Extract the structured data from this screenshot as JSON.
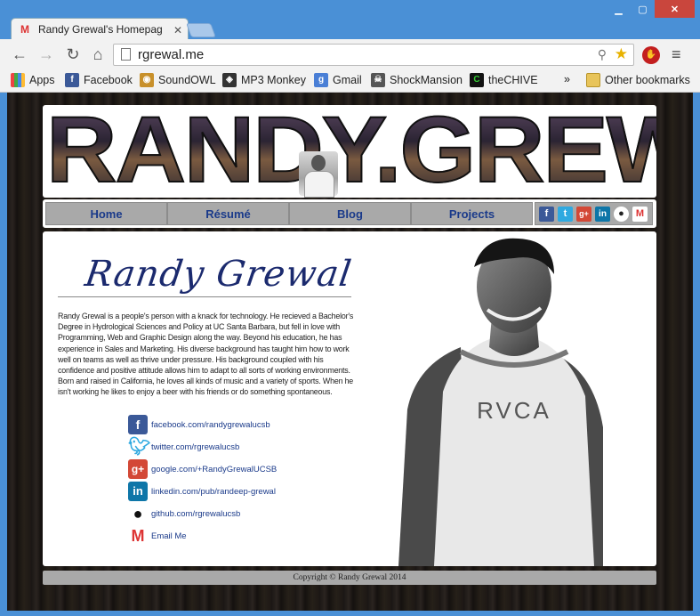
{
  "browser": {
    "tab_title": "Randy Grewal's Homepag",
    "url": "rgrewal.me",
    "bookmarks": [
      "Apps",
      "Facebook",
      "SoundOWL",
      "MP3 Monkey",
      "Gmail",
      "ShockMansion",
      "theCHIVE"
    ],
    "overflow": "»",
    "other_bookmarks": "Other bookmarks"
  },
  "site": {
    "banner_title": "RANDY.GREWAL",
    "nav": [
      "Home",
      "Résumé",
      "Blog",
      "Projects"
    ],
    "signature": "Randy Grewal",
    "bio": "Randy Grewal is a people's person with a knack for technology. He recieved a Bachelor's Degree in Hydrological Sciences and Policy at UC Santa Barbara, but fell in love with Programming, Web and Graphic Design along the way. Beyond his education, he has experience in Sales and Marketing. His diverse background has taught him how to work well on teams as well as thrive under pressure. His background coupled with his confidence and positive attitude allows him to adapt to all sorts of working environments. Born and raised in California, he loves all kinds of music and a variety of sports. When he isn't working he likes to enjoy a beer with his friends or do something spontaneous.",
    "links": {
      "facebook": "facebook.com/randygrewalucsb",
      "twitter": "twitter.com/rgrewalucsb",
      "google": "google.com/+RandyGrewalUCSB",
      "linkedin": "linkedin.com/pub/randeep-grewal",
      "github": "github.com/rgrewalucsb",
      "email": "Email Me"
    },
    "shirt_text": "RVCA",
    "footer": "Copyright © Randy Grewal 2014"
  },
  "colors": {
    "nav_text": "#1a3a8a",
    "nav_bg": "#a9a9a9",
    "signature": "#1b2a6e",
    "facebook": "#3b5998",
    "twitter": "#2fa9e0",
    "google": "#d34836",
    "linkedin": "#0e76a8"
  }
}
